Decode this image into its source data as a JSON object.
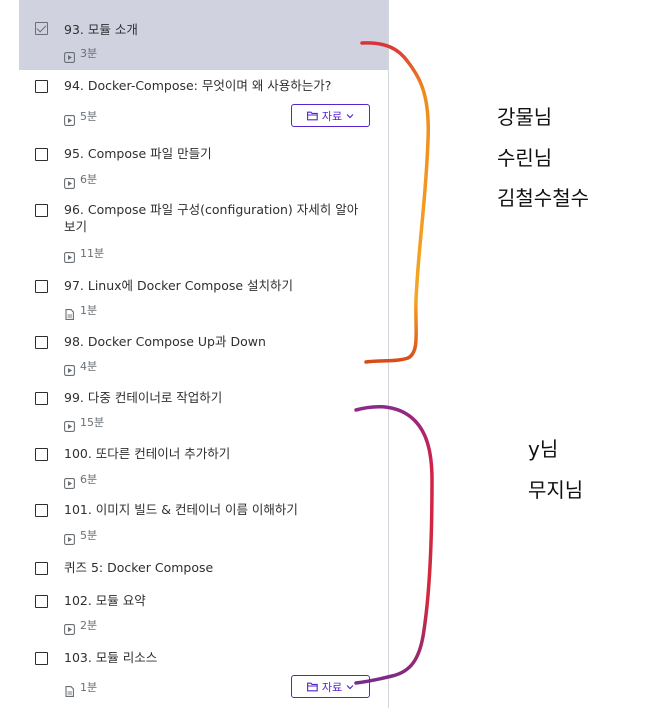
{
  "lessons": [
    {
      "title": "93. 모듈 소개",
      "duration": "3분",
      "icon": "video-icon",
      "active": true,
      "resources": false
    },
    {
      "title": "94. Docker-Compose: 무엇이며 왜 사용하는가?",
      "duration": "5분",
      "icon": "video-icon",
      "active": false,
      "resources": true
    },
    {
      "title": "95. Compose 파일 만들기",
      "duration": "6분",
      "icon": "video-icon",
      "active": false,
      "resources": false
    },
    {
      "title": "96. Compose 파일 구성(configuration) 자세히 알아보기",
      "duration": "11분",
      "icon": "video-icon",
      "active": false,
      "resources": false
    },
    {
      "title": "97. Linux에 Docker Compose 설치하기",
      "duration": "1분",
      "icon": "document-icon",
      "active": false,
      "resources": false
    },
    {
      "title": "98. Docker Compose Up과 Down",
      "duration": "4분",
      "icon": "video-icon",
      "active": false,
      "resources": false
    },
    {
      "title": "99. 다중 컨테이너로 작업하기",
      "duration": "15분",
      "icon": "video-icon",
      "active": false,
      "resources": false
    },
    {
      "title": "100. 또다른 컨테이너 추가하기",
      "duration": "6분",
      "icon": "video-icon",
      "active": false,
      "resources": false
    },
    {
      "title": "101. 이미지 빌드 & 컨테이너 이름 이해하기",
      "duration": "5분",
      "icon": "video-icon",
      "active": false,
      "resources": false
    },
    {
      "title": "퀴즈 5: Docker Compose",
      "duration": "",
      "icon": "",
      "active": false,
      "resources": false
    },
    {
      "title": "102. 모듈 요약",
      "duration": "2분",
      "icon": "video-icon",
      "active": false,
      "resources": false
    },
    {
      "title": "103. 모듈 리소스",
      "duration": "1분",
      "icon": "document-icon",
      "active": false,
      "resources": true
    }
  ],
  "resources_label": "자료",
  "colors": {
    "accent": "#5624d0",
    "active_bg": "#d0d2e0",
    "border": "#d1d7dc"
  },
  "annotations": {
    "group1": [
      "강물님",
      "수린님",
      "김철수철수"
    ],
    "group2": [
      "y님",
      "무지님"
    ]
  }
}
